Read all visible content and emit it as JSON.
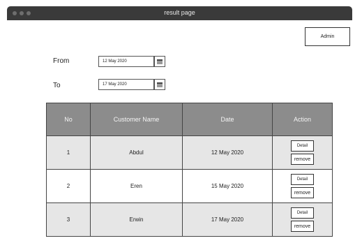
{
  "window": {
    "title": "result page"
  },
  "header": {
    "admin_label": "Admin"
  },
  "filters": {
    "from_label": "From",
    "from_value": "12 May 2020",
    "to_label": "To",
    "to_value": "17 May 2020"
  },
  "table": {
    "headers": [
      "No",
      "Customer Name",
      "Date",
      "Action"
    ],
    "rows": [
      {
        "no": "1",
        "name": "Abdul",
        "date": "12 May 2020",
        "detail": "Detail",
        "remove": "remove"
      },
      {
        "no": "2",
        "name": "Eren",
        "date": "15 May 2020",
        "detail": "Detail",
        "remove": "remove"
      },
      {
        "no": "3",
        "name": "Erwin",
        "date": "17 May 2020",
        "detail": "Detail",
        "remove": "remove"
      }
    ]
  },
  "colors": {
    "titlebar": "#3a3a3a",
    "header_bg": "#8c8c8c",
    "row_alt": "#e6e6e6"
  }
}
